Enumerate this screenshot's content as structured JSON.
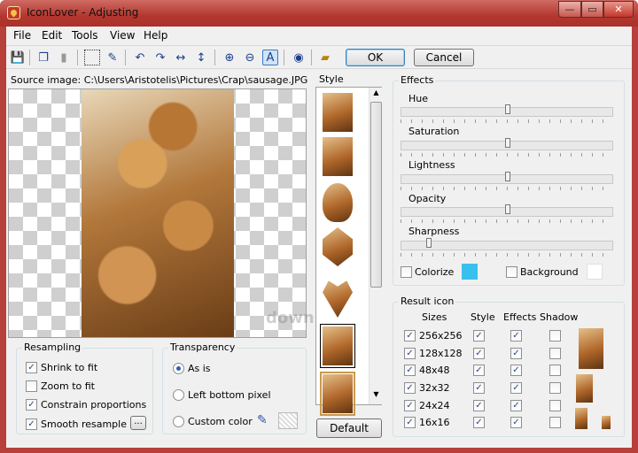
{
  "window": {
    "title": "IconLover - Adjusting",
    "min": "—",
    "max": "▭",
    "close": "✕"
  },
  "menu": [
    "File",
    "Edit",
    "Tools",
    "View",
    "Help"
  ],
  "toolbar": {
    "icons": [
      "save-icon",
      "copy-icon",
      "paste-icon",
      "select-icon",
      "eyedropper-icon",
      "rotate-left-icon",
      "rotate-right-icon",
      "flip-horizontal-icon",
      "flip-vertical-icon",
      "zoom-in-icon",
      "zoom-out-icon",
      "text-icon",
      "eye-icon",
      "book-icon"
    ],
    "ok": "OK",
    "cancel": "Cancel"
  },
  "source": {
    "label": "Source image: C:\\Users\\Aristotelis\\Pictures\\Crap\\sausage.JPG"
  },
  "resampling": {
    "title": "Resampling",
    "items": [
      {
        "label": "Shrink to fit",
        "checked": true
      },
      {
        "label": "Zoom to fit",
        "checked": false
      },
      {
        "label": "Constrain proportions",
        "checked": true
      },
      {
        "label": "Smooth resample",
        "checked": true
      }
    ],
    "more": "..."
  },
  "transparency": {
    "title": "Transparency",
    "options": [
      {
        "label": "As is",
        "selected": true
      },
      {
        "label": "Left bottom pixel",
        "selected": false
      },
      {
        "label": "Custom color",
        "selected": false
      }
    ]
  },
  "style": {
    "title": "Style",
    "default": "Default"
  },
  "effects": {
    "title": "Effects",
    "sliders": [
      {
        "label": "Hue",
        "value": 0.5
      },
      {
        "label": "Saturation",
        "value": 0.5
      },
      {
        "label": "Lightness",
        "value": 0.5
      },
      {
        "label": "Opacity",
        "value": 0.5
      },
      {
        "label": "Sharpness",
        "value": 0.12
      }
    ],
    "colorize": "Colorize",
    "background": "Background",
    "colorize_color": "#38c1ec",
    "background_color": "#ffffff"
  },
  "result": {
    "title": "Result icon",
    "headers": [
      "Sizes",
      "Style",
      "Effects",
      "Shadow"
    ],
    "rows": [
      {
        "size": "256x256",
        "style": true,
        "effects": true,
        "shadow": false
      },
      {
        "size": "128x128",
        "style": true,
        "effects": true,
        "shadow": false
      },
      {
        "size": "48x48",
        "style": true,
        "effects": true,
        "shadow": false
      },
      {
        "size": "32x32",
        "style": true,
        "effects": true,
        "shadow": false
      },
      {
        "size": "24x24",
        "style": true,
        "effects": true,
        "shadow": false
      },
      {
        "size": "16x16",
        "style": true,
        "effects": true,
        "shadow": false
      }
    ]
  },
  "watermark": "download"
}
